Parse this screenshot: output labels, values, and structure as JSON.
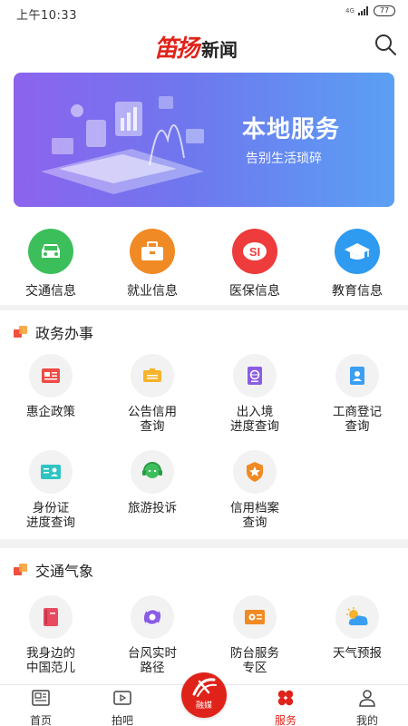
{
  "status_bar": {
    "time": "上午10:33",
    "network": "4G",
    "battery": "77"
  },
  "header": {
    "brand": "笛扬",
    "news": "新闻"
  },
  "banner": {
    "title": "本地服务",
    "subtitle": "告别生活琐碎"
  },
  "quick_services": [
    {
      "label": "交通信息",
      "icon": "car-icon",
      "color": "#3cbf5b"
    },
    {
      "label": "就业信息",
      "icon": "briefcase-icon",
      "color": "#f08a24"
    },
    {
      "label": "医保信息",
      "icon": "social-security-icon",
      "color": "#ee3b3b"
    },
    {
      "label": "教育信息",
      "icon": "graduation-cap-icon",
      "color": "#2e9af0"
    }
  ],
  "gov_section": {
    "title": "政务办事",
    "items": [
      {
        "label": "惠企政策",
        "icon": "policy-document-icon"
      },
      {
        "label": "公告信用\n查询",
        "icon": "announcement-icon"
      },
      {
        "label": "出入境\n进度查询",
        "icon": "passport-icon"
      },
      {
        "label": "工商登记\n查询",
        "icon": "business-license-icon"
      },
      {
        "label": "身份证\n进度查询",
        "icon": "id-card-icon"
      },
      {
        "label": "旅游投诉",
        "icon": "customer-service-icon"
      },
      {
        "label": "信用档案\n查询",
        "icon": "credit-badge-icon"
      }
    ]
  },
  "traffic_section": {
    "title": "交通气象",
    "items": [
      {
        "label": "我身边的\n中国范儿",
        "icon": "book-icon"
      },
      {
        "label": "台风实时\n路径",
        "icon": "typhoon-icon"
      },
      {
        "label": "防台服务\n专区",
        "icon": "shelter-service-icon"
      },
      {
        "label": "天气预报",
        "icon": "weather-icon"
      }
    ]
  },
  "tab_bar": {
    "tabs": [
      {
        "label": "首页",
        "icon": "newspaper-icon"
      },
      {
        "label": "拍吧",
        "icon": "video-icon"
      },
      {
        "label": "融媒",
        "icon": "media-logo-icon"
      },
      {
        "label": "服务",
        "icon": "services-grid-icon",
        "active": true
      },
      {
        "label": "我的",
        "icon": "user-icon"
      }
    ]
  },
  "colors": {
    "brand_red": "#e0231a",
    "section_mark_red": "#f0503c",
    "section_mark_orange": "#f7a23b"
  }
}
